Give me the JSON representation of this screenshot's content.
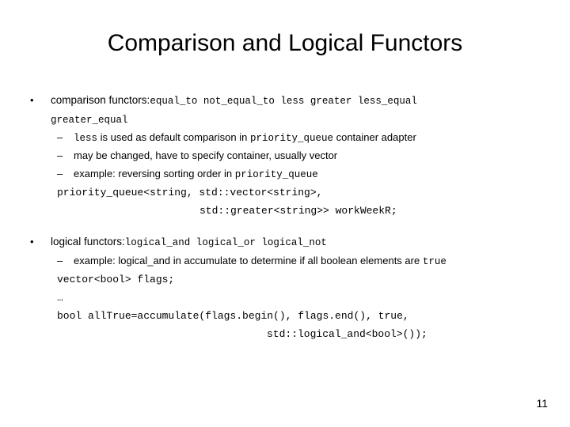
{
  "slide": {
    "title": "Comparison and Logical Functors",
    "page_number": "11",
    "background_color": "#ffffff",
    "text_color": "#000000"
  },
  "bullets": [
    {
      "marker": "•",
      "lead_text": "comparison functors:",
      "lead_code": "equal_to  not_equal_to  less  greater  less_equal",
      "continuation_code": "greater_equal",
      "sub_bullets": [
        {
          "marker": "–",
          "parts": [
            {
              "style": "code",
              "text": "less"
            },
            {
              "style": "prose",
              "text": " is used as default comparison in "
            },
            {
              "style": "code",
              "text": "priority_queue"
            },
            {
              "style": "prose",
              "text": " container adapter"
            }
          ]
        },
        {
          "marker": "–",
          "parts": [
            {
              "style": "prose",
              "text": "may be changed, have to specify container, usually vector"
            }
          ]
        },
        {
          "marker": "–",
          "parts": [
            {
              "style": "prose",
              "text": "example: reversing sorting order in "
            },
            {
              "style": "code",
              "text": "priority_queue"
            }
          ]
        }
      ],
      "code_lines": [
        {
          "indent": "code-indent-1",
          "text": "priority_queue<string, std::vector<string>,"
        },
        {
          "indent": "code-indent-2",
          "text": "std::greater<string>> workWeekR;"
        }
      ]
    },
    {
      "marker": "•",
      "lead_text": "logical functors:",
      "lead_code": "logical_and  logical_or  logical_not",
      "sub_bullets": [
        {
          "marker": "–",
          "parts": [
            {
              "style": "prose",
              "text": "example: logical_and in accumulate to determine if all boolean elements are "
            },
            {
              "style": "code",
              "text": "true"
            }
          ]
        }
      ],
      "code_lines": [
        {
          "indent": "code-indent-1",
          "text": "vector<bool> flags;"
        },
        {
          "indent": "code-indent-1",
          "text": "…"
        },
        {
          "indent": "code-indent-1",
          "text": "bool allTrue=accumulate(flags.begin(), flags.end(), true,"
        },
        {
          "indent": "code-indent-3",
          "text": "std::logical_and<bool>());"
        }
      ]
    }
  ]
}
